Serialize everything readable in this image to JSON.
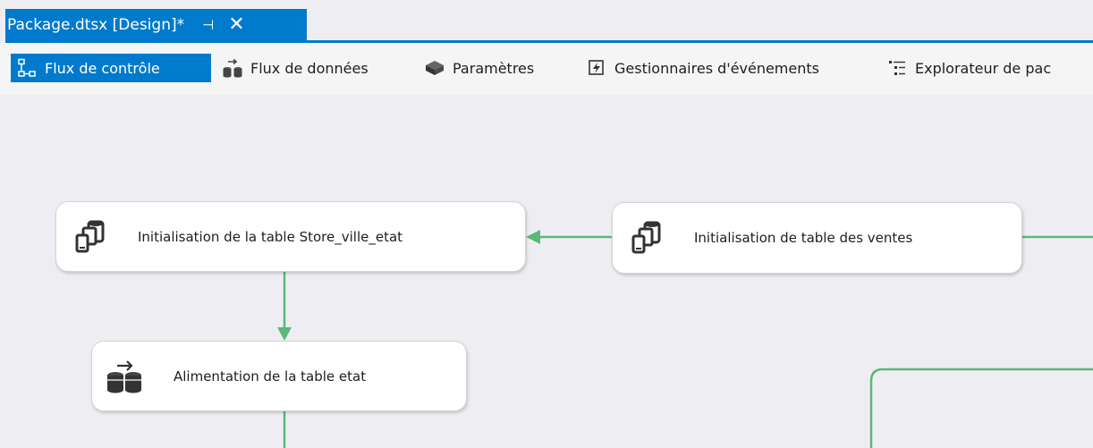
{
  "document_tab": {
    "title": "Package.dtsx [Design]*",
    "pin_glyph": "⊣",
    "close_glyph": "✕"
  },
  "designer_tabs": [
    {
      "label": "Flux de contrôle",
      "icon": "control-flow-icon",
      "active": true
    },
    {
      "label": "Flux de données",
      "icon": "data-flow-icon",
      "active": false
    },
    {
      "label": "Paramètres",
      "icon": "parameters-icon",
      "active": false
    },
    {
      "label": "Gestionnaires d'événements",
      "icon": "event-handlers-icon",
      "active": false
    },
    {
      "label": "Explorateur de pac",
      "icon": "package-explorer-icon",
      "active": false
    }
  ],
  "tasks": [
    {
      "label": "Initialisation de la table Store_ville_etat",
      "icon": "execute-sql-task-icon"
    },
    {
      "label": "Initialisation de table des ventes",
      "icon": "execute-sql-task-icon"
    },
    {
      "label": "Alimentation de la table etat",
      "icon": "data-flow-task-icon"
    }
  ],
  "colors": {
    "accent": "#007acc",
    "precedence_success": "#5cb877",
    "canvas": "#eeeef2"
  }
}
